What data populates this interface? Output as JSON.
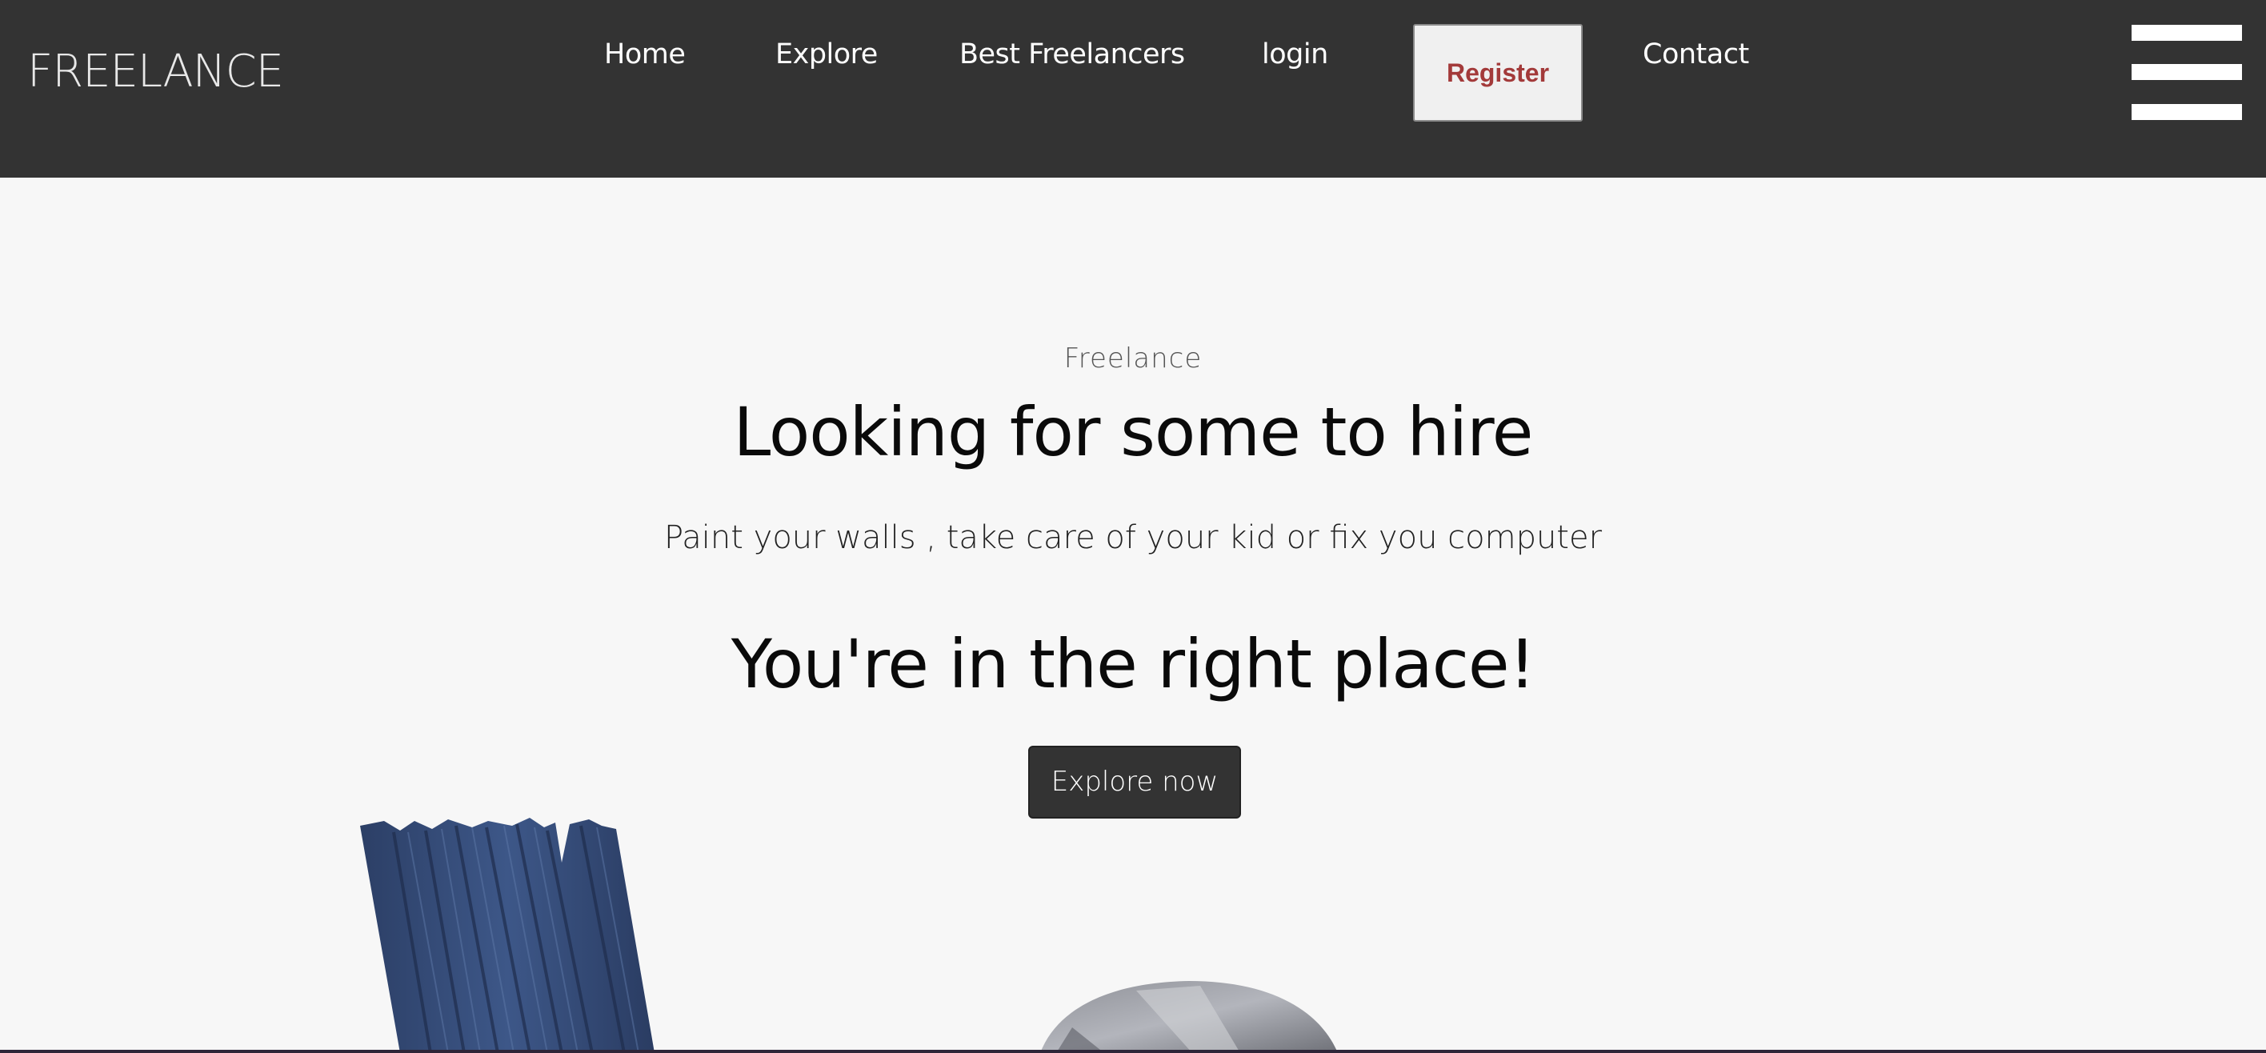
{
  "nav": {
    "brand": "FREELANCE",
    "links": {
      "home": "Home",
      "explore": "Explore",
      "best_freelancers": "Best Freelancers",
      "login": "login",
      "contact": "Contact"
    },
    "register_label": "Register",
    "menu_icon": "hamburger-menu-icon"
  },
  "hero": {
    "eyebrow": "Freelance",
    "title": "Looking for some to hire",
    "subtitle": "Paint your walls , take care of your kid or fix you computer",
    "tagline": "You're in the right place!",
    "cta_label": "Explore now"
  },
  "colors": {
    "nav_background": "#333333",
    "page_background": "#f7f7f7",
    "register_text": "#a33a3a",
    "register_background": "#f0f0f0",
    "cta_background": "#333333"
  },
  "images": {
    "left": "paint-brush-image",
    "center": "cap-image"
  }
}
